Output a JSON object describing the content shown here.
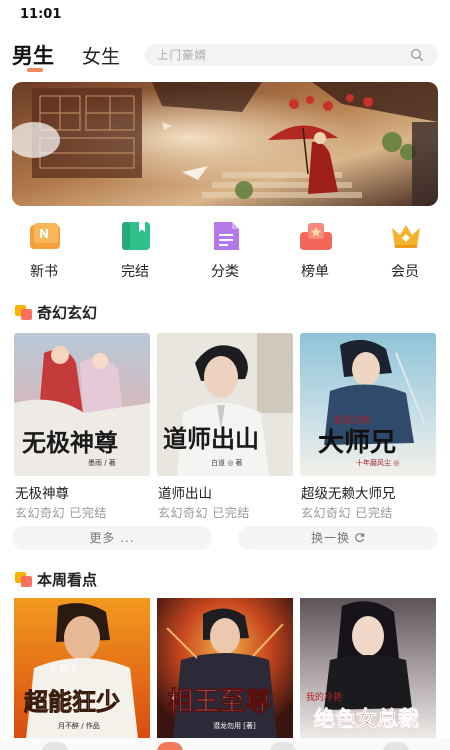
{
  "status_bar": {
    "time": "11:01"
  },
  "top_nav": {
    "tabs": [
      {
        "label": "男生",
        "active": true
      },
      {
        "label": "女生",
        "active": false
      }
    ],
    "search": {
      "placeholder": "上门豪婿",
      "icon": "search-icon"
    }
  },
  "quick_nav": [
    {
      "label": "新书",
      "icon": "new-book-icon",
      "color": "#f5a03c"
    },
    {
      "label": "完结",
      "icon": "finished-book-icon",
      "color": "#2fc08c"
    },
    {
      "label": "分类",
      "icon": "category-document-icon",
      "color": "#b478e8"
    },
    {
      "label": "榜单",
      "icon": "ranking-icon",
      "color": "#f2675a"
    },
    {
      "label": "会员",
      "icon": "vip-crown-icon",
      "color": "#f5b22c"
    }
  ],
  "sections": [
    {
      "title": "奇幻玄幻",
      "books": [
        {
          "title": "无极神尊",
          "genre": "玄幻奇幻",
          "status": "已完结",
          "cover_title": "无极神尊",
          "cover_author": "墨雨 / 著"
        },
        {
          "title": "道师出山",
          "genre": "玄幻奇幻",
          "status": "已完结",
          "cover_title": "道师出山",
          "cover_author": "白道 ◎ 著"
        },
        {
          "title": "超级无赖大师兄",
          "genre": "玄幻奇幻",
          "status": "已完结",
          "cover_title": "大师兄",
          "cover_subtitle": "超级无赖",
          "cover_author": "十年磨风尘 ◎"
        }
      ],
      "more_label": "更多 ...",
      "swap_label": "换一换"
    },
    {
      "title": "本周看点",
      "books": [
        {
          "cover_title": "超能狂少",
          "cover_subtitle": "在都市",
          "cover_author": "月不醉 / 作品"
        },
        {
          "cover_title": "相王至尊",
          "cover_author": "潜龙勿用 [著]"
        },
        {
          "cover_title": "绝色女总裁",
          "cover_subtitle": "我的冷艳",
          "cover_author": ""
        }
      ]
    }
  ],
  "colors": {
    "accent": "#f08a5d",
    "section_icon_a": "#f7b500",
    "section_icon_b": "#f56c5a"
  }
}
